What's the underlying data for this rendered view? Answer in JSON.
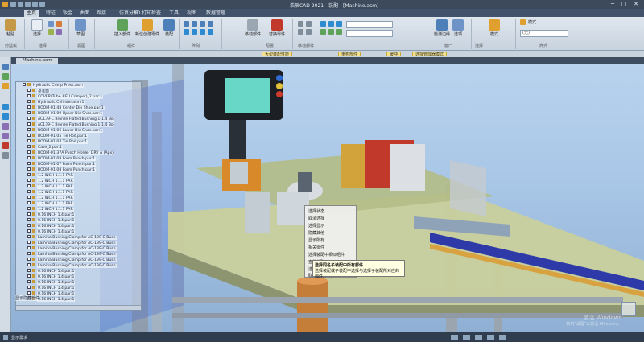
{
  "window": {
    "title": "浩辰CAD 2021 - 装配 - [Machine.asm]",
    "minimize": "─",
    "maximize": "□",
    "close": "✕"
  },
  "ribbon_tabs": [
    "主页",
    "特征",
    "钣金",
    "曲面",
    "焊接",
    "仿真分析",
    "3D 打印",
    "检查",
    "工具",
    "视图",
    "数据管理"
  ],
  "ribbon": {
    "groups": [
      {
        "label": "剪贴板",
        "buttons": [
          "粘贴"
        ]
      },
      {
        "label": "选择",
        "buttons": [
          "选择"
        ]
      },
      {
        "label": "视图",
        "buttons": [
          "草图"
        ]
      },
      {
        "label": "组件",
        "buttons": [
          "插入部件",
          "新位创建零件",
          "装配"
        ]
      },
      {
        "label": "阵列",
        "buttons": []
      },
      {
        "label": "配置",
        "buttons": [
          "移动部件",
          "替换零件"
        ]
      },
      {
        "label": "移动部件",
        "buttons": []
      },
      {
        "label": "窗口",
        "buttons": [
          "检测边缘",
          "选项"
        ]
      },
      {
        "label": "选择",
        "buttons": [
          "模式"
        ]
      },
      {
        "label": "样式",
        "buttons": []
      }
    ],
    "mode_label": "模式",
    "style_value": "(无)"
  },
  "hint_tags": [
    "大型装配性能",
    "重构部件",
    "缓冲",
    "选择管理器模式"
  ],
  "document_tab": "Machine.asm",
  "tree": {
    "root": "Hydraulic Crimp Press.asm",
    "items": [
      "基准面",
      "COVER(Tube #FU Crimper)_2.par:1",
      "Hydraulic Cylinder.asm:1",
      "BOOM-01-48 Center Die Shoe.par:1",
      "BOOM-01-09 Upper Die Shoe.par:1",
      "AC139-C Bronze Flated Bushing 1-1.4 Bo",
      "AC139-C Bronze Flated Bushing 1-1.4 Bo",
      "BOOM-01-06 Lower Die Shoe.par:1",
      "BOOM-01-05 Tie Rod.par:1",
      "BOOM-01-04 Tie Rod.par:1",
      "Case_2.par:1",
      "BOOM-01-37A Punch Holder DRV A (Apx)",
      "BOOM-01-08 Form Punch.par:1",
      "BOOM-01-07 Form Punch.par:1",
      "BOOM-01-08 Form Punch.par:1",
      "1.2 INCH 1.1.1 PAR",
      "1.2 INCH 1.1.1 PAR",
      "1.2 INCH 1.1.1 PAR",
      "1.2 INCH 1.1.1 PAR",
      "1.2 INCH 1.1.1 PAR",
      "1.2 INCH 1.1.1 PAR",
      "1.2 INCH 1.1.1 PAR",
      "0.16 INCH 1.4.par:1",
      "0.16 INCH 1.4.par:1",
      "0.16 INCH 1.4.par:1",
      "0.16 INCH 1.4.par:1",
      "Lamina Bushing Clamp for AC-139-C Bush",
      "Lamina Bushing Clamp for AC-139-C Bush",
      "Lamina Bushing Clamp for AC-139-C Bush",
      "Lamina Bushing Clamp for AC-139-C Bush",
      "Lamina Bushing Clamp for AC-139-C Bush",
      "Lamina Bushing Clamp for AC-139-C Bush",
      "0.16 INCH 1.4.par:1",
      "0.16 INCH 1.4.par:1",
      "0.16 INCH 1.4.par:1",
      "0.16 INCH 1.4.par:1",
      "0.16 INCH 1.4.par:1",
      "0.16 INCH 1.4.par:1"
    ],
    "footer": "显示隐藏部件"
  },
  "context_menu": [
    "选择状态",
    "取消选择",
    "选择显示",
    "隐藏其他",
    "显示所有",
    "相关零件",
    "选择装配中相似组件",
    "查找关联",
    "选择此块件",
    "取消选择块件"
  ],
  "tooltip": {
    "title": "选择同名子装配中所有部件",
    "text": "选择装配或子装配中选择与选择子装配所对应的部件。"
  },
  "status": {
    "left": "显示需求",
    "watermark_line1": "激活 Windows",
    "watermark_line2": "转到\"设置\"以激活 Windows。"
  }
}
